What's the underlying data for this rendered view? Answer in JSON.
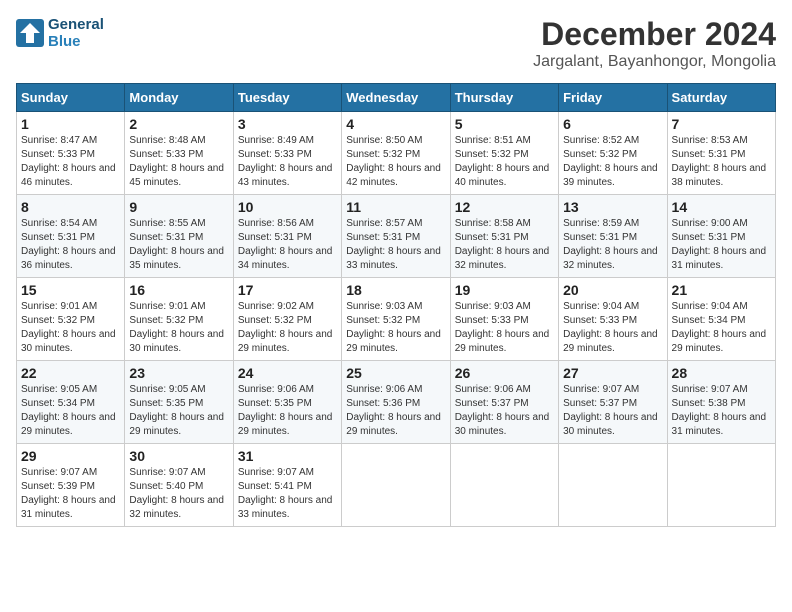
{
  "logo": {
    "line1": "General",
    "line2": "Blue"
  },
  "title": "December 2024",
  "location": "Jargalant, Bayanhongor, Mongolia",
  "days_of_week": [
    "Sunday",
    "Monday",
    "Tuesday",
    "Wednesday",
    "Thursday",
    "Friday",
    "Saturday"
  ],
  "weeks": [
    [
      {
        "day": "1",
        "sunrise": "Sunrise: 8:47 AM",
        "sunset": "Sunset: 5:33 PM",
        "daylight": "Daylight: 8 hours and 46 minutes."
      },
      {
        "day": "2",
        "sunrise": "Sunrise: 8:48 AM",
        "sunset": "Sunset: 5:33 PM",
        "daylight": "Daylight: 8 hours and 45 minutes."
      },
      {
        "day": "3",
        "sunrise": "Sunrise: 8:49 AM",
        "sunset": "Sunset: 5:33 PM",
        "daylight": "Daylight: 8 hours and 43 minutes."
      },
      {
        "day": "4",
        "sunrise": "Sunrise: 8:50 AM",
        "sunset": "Sunset: 5:32 PM",
        "daylight": "Daylight: 8 hours and 42 minutes."
      },
      {
        "day": "5",
        "sunrise": "Sunrise: 8:51 AM",
        "sunset": "Sunset: 5:32 PM",
        "daylight": "Daylight: 8 hours and 40 minutes."
      },
      {
        "day": "6",
        "sunrise": "Sunrise: 8:52 AM",
        "sunset": "Sunset: 5:32 PM",
        "daylight": "Daylight: 8 hours and 39 minutes."
      },
      {
        "day": "7",
        "sunrise": "Sunrise: 8:53 AM",
        "sunset": "Sunset: 5:31 PM",
        "daylight": "Daylight: 8 hours and 38 minutes."
      }
    ],
    [
      {
        "day": "8",
        "sunrise": "Sunrise: 8:54 AM",
        "sunset": "Sunset: 5:31 PM",
        "daylight": "Daylight: 8 hours and 36 minutes."
      },
      {
        "day": "9",
        "sunrise": "Sunrise: 8:55 AM",
        "sunset": "Sunset: 5:31 PM",
        "daylight": "Daylight: 8 hours and 35 minutes."
      },
      {
        "day": "10",
        "sunrise": "Sunrise: 8:56 AM",
        "sunset": "Sunset: 5:31 PM",
        "daylight": "Daylight: 8 hours and 34 minutes."
      },
      {
        "day": "11",
        "sunrise": "Sunrise: 8:57 AM",
        "sunset": "Sunset: 5:31 PM",
        "daylight": "Daylight: 8 hours and 33 minutes."
      },
      {
        "day": "12",
        "sunrise": "Sunrise: 8:58 AM",
        "sunset": "Sunset: 5:31 PM",
        "daylight": "Daylight: 8 hours and 32 minutes."
      },
      {
        "day": "13",
        "sunrise": "Sunrise: 8:59 AM",
        "sunset": "Sunset: 5:31 PM",
        "daylight": "Daylight: 8 hours and 32 minutes."
      },
      {
        "day": "14",
        "sunrise": "Sunrise: 9:00 AM",
        "sunset": "Sunset: 5:31 PM",
        "daylight": "Daylight: 8 hours and 31 minutes."
      }
    ],
    [
      {
        "day": "15",
        "sunrise": "Sunrise: 9:01 AM",
        "sunset": "Sunset: 5:32 PM",
        "daylight": "Daylight: 8 hours and 30 minutes."
      },
      {
        "day": "16",
        "sunrise": "Sunrise: 9:01 AM",
        "sunset": "Sunset: 5:32 PM",
        "daylight": "Daylight: 8 hours and 30 minutes."
      },
      {
        "day": "17",
        "sunrise": "Sunrise: 9:02 AM",
        "sunset": "Sunset: 5:32 PM",
        "daylight": "Daylight: 8 hours and 29 minutes."
      },
      {
        "day": "18",
        "sunrise": "Sunrise: 9:03 AM",
        "sunset": "Sunset: 5:32 PM",
        "daylight": "Daylight: 8 hours and 29 minutes."
      },
      {
        "day": "19",
        "sunrise": "Sunrise: 9:03 AM",
        "sunset": "Sunset: 5:33 PM",
        "daylight": "Daylight: 8 hours and 29 minutes."
      },
      {
        "day": "20",
        "sunrise": "Sunrise: 9:04 AM",
        "sunset": "Sunset: 5:33 PM",
        "daylight": "Daylight: 8 hours and 29 minutes."
      },
      {
        "day": "21",
        "sunrise": "Sunrise: 9:04 AM",
        "sunset": "Sunset: 5:34 PM",
        "daylight": "Daylight: 8 hours and 29 minutes."
      }
    ],
    [
      {
        "day": "22",
        "sunrise": "Sunrise: 9:05 AM",
        "sunset": "Sunset: 5:34 PM",
        "daylight": "Daylight: 8 hours and 29 minutes."
      },
      {
        "day": "23",
        "sunrise": "Sunrise: 9:05 AM",
        "sunset": "Sunset: 5:35 PM",
        "daylight": "Daylight: 8 hours and 29 minutes."
      },
      {
        "day": "24",
        "sunrise": "Sunrise: 9:06 AM",
        "sunset": "Sunset: 5:35 PM",
        "daylight": "Daylight: 8 hours and 29 minutes."
      },
      {
        "day": "25",
        "sunrise": "Sunrise: 9:06 AM",
        "sunset": "Sunset: 5:36 PM",
        "daylight": "Daylight: 8 hours and 29 minutes."
      },
      {
        "day": "26",
        "sunrise": "Sunrise: 9:06 AM",
        "sunset": "Sunset: 5:37 PM",
        "daylight": "Daylight: 8 hours and 30 minutes."
      },
      {
        "day": "27",
        "sunrise": "Sunrise: 9:07 AM",
        "sunset": "Sunset: 5:37 PM",
        "daylight": "Daylight: 8 hours and 30 minutes."
      },
      {
        "day": "28",
        "sunrise": "Sunrise: 9:07 AM",
        "sunset": "Sunset: 5:38 PM",
        "daylight": "Daylight: 8 hours and 31 minutes."
      }
    ],
    [
      {
        "day": "29",
        "sunrise": "Sunrise: 9:07 AM",
        "sunset": "Sunset: 5:39 PM",
        "daylight": "Daylight: 8 hours and 31 minutes."
      },
      {
        "day": "30",
        "sunrise": "Sunrise: 9:07 AM",
        "sunset": "Sunset: 5:40 PM",
        "daylight": "Daylight: 8 hours and 32 minutes."
      },
      {
        "day": "31",
        "sunrise": "Sunrise: 9:07 AM",
        "sunset": "Sunset: 5:41 PM",
        "daylight": "Daylight: 8 hours and 33 minutes."
      },
      null,
      null,
      null,
      null
    ]
  ]
}
